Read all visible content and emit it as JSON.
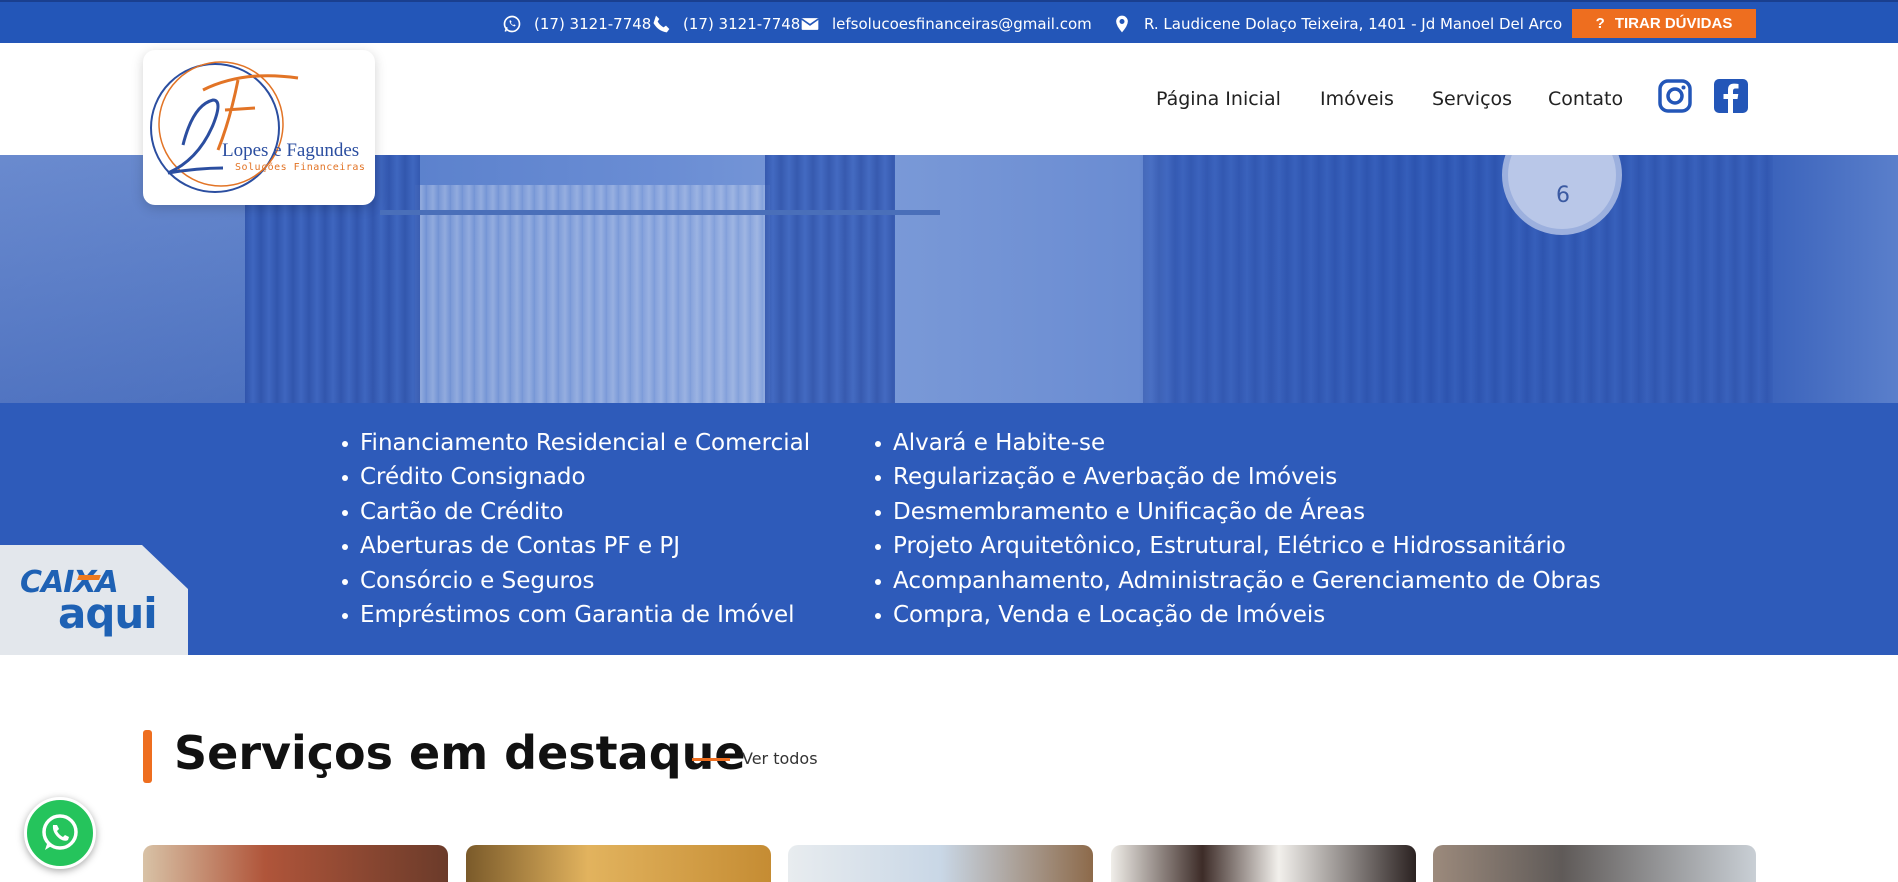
{
  "topbar": {
    "whatsapp": "(17) 3121-7748",
    "phone": "(17) 3121-7748",
    "email": "lefsolucoesfinanceiras@gmail.com",
    "address": "R. Laudicene Dolaço Teixeira, 1401 - Jd Manoel Del Arco",
    "cta_icon": "?",
    "cta_label": "TIRAR DÚVIDAS"
  },
  "logo": {
    "name": "Lopes e Fagundes",
    "subtitle": "Soluções Financeiras"
  },
  "nav": {
    "items": [
      "Página Inicial",
      "Imóveis",
      "Serviços",
      "Contato"
    ],
    "social": [
      "instagram-icon",
      "facebook-icon"
    ]
  },
  "hero": {
    "clock_digit": "6"
  },
  "services": {
    "left": [
      "Financiamento Residencial e Comercial",
      "Crédito Consignado",
      "Cartão de Crédito",
      "Aberturas de Contas PF e PJ",
      "Consórcio e Seguros",
      "Empréstimos com Garantia de Imóvel"
    ],
    "right": [
      "Alvará e Habite-se",
      "Regularização e Averbação de Imóveis",
      "Desmembramento e Unificação de Áreas",
      "Projeto Arquitetônico, Estrutural, Elétrico e Hidrossanitário",
      "Acompanhamento, Administração e Gerenciamento de Obras",
      "Compra, Venda e Locação de Imóveis"
    ]
  },
  "badge": {
    "caixa_line1": "CAIXA",
    "caixa_line2": "aqui"
  },
  "featured": {
    "title": "Serviços em destaque",
    "see_all": "Ver todos"
  },
  "colors": {
    "primary": "#2e5bba",
    "topbar": "#2356b8",
    "accent": "#ee6e1f",
    "whatsapp": "#25c45c"
  }
}
